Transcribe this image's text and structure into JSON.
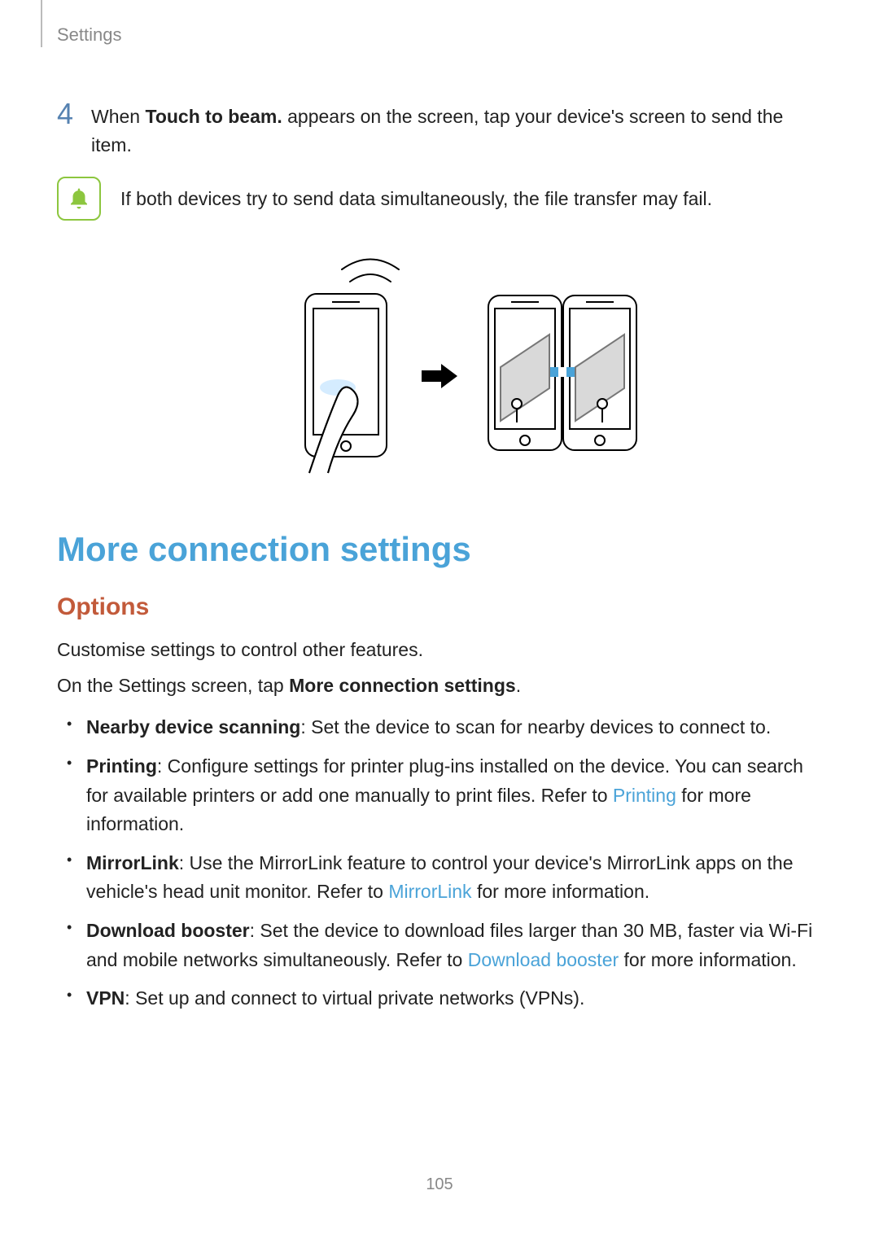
{
  "header": "Settings",
  "step": {
    "num": "4",
    "pre": "When ",
    "bold": "Touch to beam.",
    "post": " appears on the screen, tap your device's screen to send the item."
  },
  "note": "If both devices try to send data simultaneously, the file transfer may fail.",
  "h1": "More connection settings",
  "h2": "Options",
  "p1": "Customise settings to control other features.",
  "p2_pre": "On the Settings screen, tap ",
  "p2_bold": "More connection settings",
  "p2_post": ".",
  "opts": {
    "nearby": {
      "t": "Nearby device scanning",
      "d": ": Set the device to scan for nearby devices to connect to."
    },
    "printing": {
      "t": "Printing",
      "d1": ": Configure settings for printer plug-ins installed on the device. You can search for available printers or add one manually to print files. Refer to ",
      "link": "Printing",
      "d2": " for more information."
    },
    "mirror": {
      "t": "MirrorLink",
      "d1": ": Use the MirrorLink feature to control your device's MirrorLink apps on the vehicle's head unit monitor. Refer to ",
      "link": "MirrorLink",
      "d2": " for more information."
    },
    "dl": {
      "t": "Download booster",
      "d1": ": Set the device to download files larger than 30 MB, faster via Wi-Fi and mobile networks simultaneously. Refer to ",
      "link": "Download booster",
      "d2": " for more information."
    },
    "vpn": {
      "t": "VPN",
      "d": ": Set up and connect to virtual private networks (VPNs)."
    }
  },
  "page_num": "105"
}
